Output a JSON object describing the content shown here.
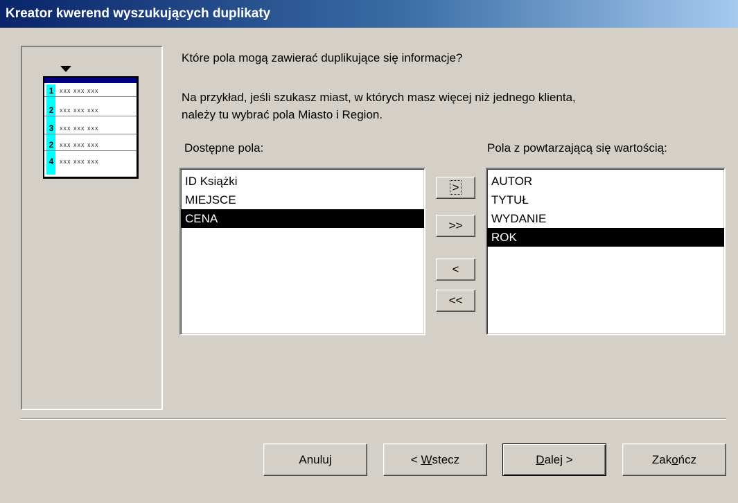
{
  "window": {
    "title": "Kreator kwerend wyszukujących duplikaty"
  },
  "illustration": {
    "row_numbers": [
      "1",
      "2",
      "3",
      "2",
      "4"
    ],
    "cell_text": "xxx xxx xxx"
  },
  "instructions": {
    "question": "Które pola mogą zawierać duplikujące się informacje?",
    "example_line1": "Na przykład, jeśli szukasz miast, w których masz więcej niż jednego klienta,",
    "example_line2": "należy tu wybrać pola Miasto i Region."
  },
  "available_fields": {
    "label": "Dostępne pola:",
    "items": [
      "ID Książki",
      "MIEJSCE",
      "CENA"
    ],
    "selected": "CENA"
  },
  "duplicate_fields": {
    "label": "Pola z powtarzającą się wartością:",
    "items": [
      "AUTOR",
      "TYTUŁ",
      "WYDANIE",
      "ROK"
    ],
    "selected": "ROK"
  },
  "move_buttons": {
    "add_one": ">",
    "add_all": ">>",
    "remove_one": "<",
    "remove_all": "<<"
  },
  "footer": {
    "cancel": "Anuluj",
    "back_prefix": "< ",
    "back_mnemonic": "W",
    "back_rest": "stecz",
    "next_mnemonic": "D",
    "next_rest": "alej >",
    "finish_prefix": "Zak",
    "finish_mnemonic": "o",
    "finish_rest": "ńcz"
  }
}
